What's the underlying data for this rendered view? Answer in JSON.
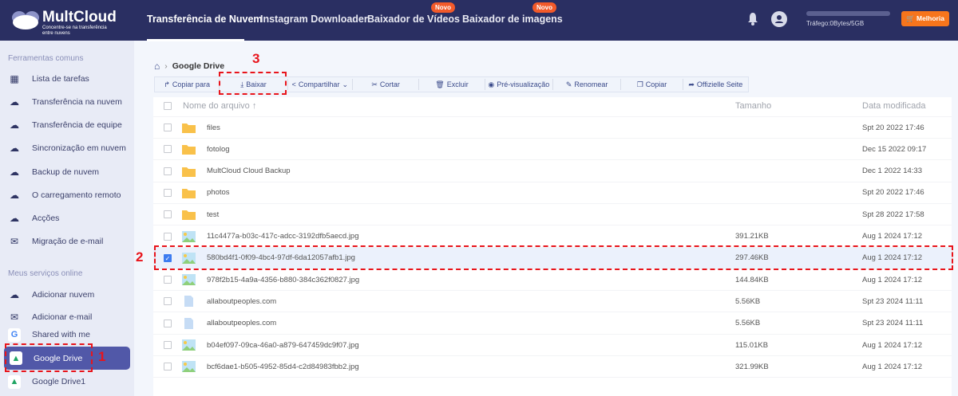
{
  "header": {
    "brand": "MultCloud",
    "tagline": "Concentre-se na transferência entre nuvens",
    "nav": [
      {
        "label": "Transferência de Nuvem"
      },
      {
        "label": "Instagram Downloader"
      },
      {
        "label": "Baixador de Vídeos",
        "badge": "Novo"
      },
      {
        "label": "Baixador de imagens",
        "badge": "Novo"
      }
    ],
    "traffic": "Tráfego:0Bytes/5GB",
    "traffic_used": 0,
    "upgrade": "Melhoria"
  },
  "sidebar": {
    "section1": "Ferramentas comuns",
    "tools": [
      "Lista de tarefas",
      "Transferência na nuvem",
      "Transferência de equipe",
      "Sincronização em nuvem",
      "Backup de nuvem",
      "O carregamento remoto",
      "Acções",
      "Migração de e-mail"
    ],
    "section2": "Meus serviços online",
    "services": [
      "Adicionar nuvem",
      "Adicionar e-mail",
      "Shared with me",
      "Google Drive",
      "Google Drive1"
    ]
  },
  "breadcrumb": "Google Drive",
  "toolbar": [
    "Copiar para",
    "Baixar",
    "Compartilhar",
    "Cortar",
    "Excluir",
    "Pré-visualização",
    "Renomear",
    "Copiar",
    "Offizielle Seite"
  ],
  "table": {
    "headers": {
      "name": "Nome do arquivo",
      "size": "Tamanho",
      "date": "Data modificada"
    },
    "rows": [
      {
        "type": "folder",
        "name": "files",
        "size": "",
        "date": "Spt 20 2022 17:46"
      },
      {
        "type": "folder",
        "name": "fotolog",
        "size": "",
        "date": "Dec 15 2022 09:17"
      },
      {
        "type": "folder",
        "name": "MultCloud Cloud Backup",
        "size": "",
        "date": "Dec 1 2022 14:33"
      },
      {
        "type": "folder",
        "name": "photos",
        "size": "",
        "date": "Spt 20 2022 17:46"
      },
      {
        "type": "folder",
        "name": "test",
        "size": "",
        "date": "Spt 28 2022 17:58"
      },
      {
        "type": "image",
        "name": "11c4477a-b03c-417c-adcc-3192dfb5aecd.jpg",
        "size": "391.21KB",
        "date": "Aug 1 2024 17:12"
      },
      {
        "type": "image",
        "name": "580bd4f1-0f09-4bc4-97df-6da12057afb1.jpg",
        "size": "297.46KB",
        "date": "Aug 1 2024 17:12",
        "selected": true
      },
      {
        "type": "image",
        "name": "978f2b15-4a9a-4356-b880-384c362f0827.jpg",
        "size": "144.84KB",
        "date": "Aug 1 2024 17:12"
      },
      {
        "type": "doc",
        "name": "allaboutpeoples.com",
        "size": "5.56KB",
        "date": "Spt 23 2024 11:11"
      },
      {
        "type": "doc",
        "name": "allaboutpeoples.com",
        "size": "5.56KB",
        "date": "Spt 23 2024 11:11"
      },
      {
        "type": "image",
        "name": "b04ef097-09ca-46a0-a879-647459dc9f07.jpg",
        "size": "115.01KB",
        "date": "Aug 1 2024 17:12"
      },
      {
        "type": "image",
        "name": "bcf6dae1-b505-4952-85d4-c2d84983fbb2.jpg",
        "size": "321.99KB",
        "date": "Aug 1 2024 17:12"
      }
    ]
  },
  "annotations": [
    "1",
    "2",
    "3"
  ]
}
